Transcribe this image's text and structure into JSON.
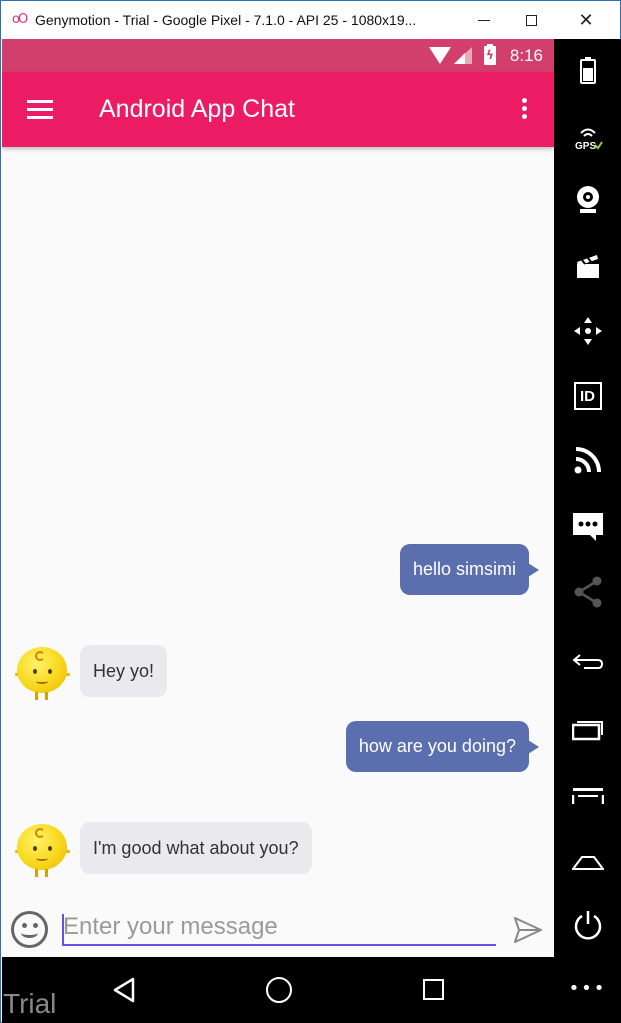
{
  "window": {
    "title": "Genymotion - Trial - Google Pixel - 7.1.0 - API 25 - 1080x19...",
    "logo_glyph": "oO",
    "minimize_icon": "minimize-icon",
    "maximize_icon": "maximize-icon",
    "close_glyph": "✕"
  },
  "statusbar": {
    "time": "8:16",
    "icons": [
      "wifi-icon",
      "signal-icon",
      "battery-charging-icon"
    ]
  },
  "appbar": {
    "title": "Android App Chat",
    "menu_icon": "hamburger-menu-icon",
    "overflow_icon": "overflow-menu-icon",
    "color": "#ec1c64"
  },
  "messages": [
    {
      "side": "right",
      "text": "hello simsimi"
    },
    {
      "side": "left",
      "text": "Hey yo!"
    },
    {
      "side": "right",
      "text": "how are you doing?"
    },
    {
      "side": "left",
      "text": "I'm good what about you?"
    }
  ],
  "composer": {
    "placeholder": "Enter your message",
    "value": "",
    "emoji_icon": "emoji-icon",
    "send_icon": "send-icon"
  },
  "navbar": {
    "icons": [
      "back-icon",
      "home-icon",
      "recents-icon"
    ]
  },
  "watermark": "Trial",
  "sidebar": {
    "items": [
      {
        "name": "battery",
        "label": ""
      },
      {
        "name": "gps",
        "label": "GPS"
      },
      {
        "name": "camera",
        "label": ""
      },
      {
        "name": "media",
        "label": ""
      },
      {
        "name": "dpad",
        "label": ""
      },
      {
        "name": "identifiers",
        "label": "ID"
      },
      {
        "name": "network",
        "label": ""
      },
      {
        "name": "sms",
        "label": ""
      },
      {
        "name": "share",
        "label": ""
      },
      {
        "name": "back",
        "label": ""
      },
      {
        "name": "recent-apps",
        "label": ""
      },
      {
        "name": "menu",
        "label": ""
      },
      {
        "name": "home",
        "label": ""
      },
      {
        "name": "power",
        "label": ""
      },
      {
        "name": "more",
        "label": "•••"
      }
    ]
  },
  "colors": {
    "statusbar": "#d23f6c",
    "bubble_out": "#5b6fae",
    "bubble_in": "#e9e9ee",
    "input_underline": "#6a4fe0"
  }
}
